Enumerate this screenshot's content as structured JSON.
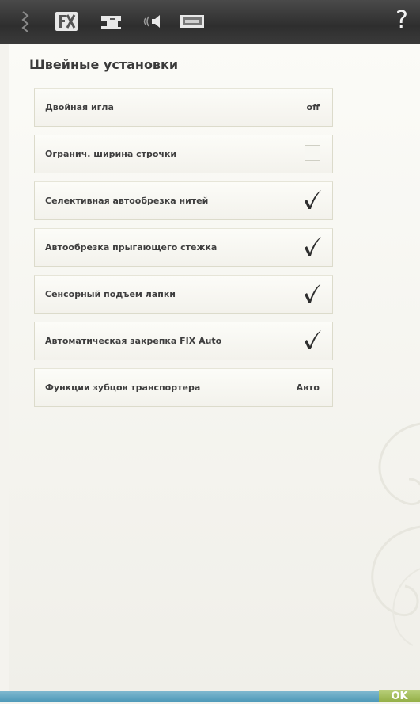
{
  "toolbar": {
    "icons": [
      "stitch-settings-icon",
      "fix-icon",
      "sewing-machine-icon",
      "sound-icon",
      "screen-icon"
    ],
    "help_label": "?"
  },
  "page": {
    "title": "Швейные установки"
  },
  "settings": [
    {
      "label": "Двойная игла",
      "value": "off",
      "control": "value"
    },
    {
      "label": "Огранич. ширина строчки",
      "control": "checkbox",
      "checked": false
    },
    {
      "label": "Селективная автообрезка нитей",
      "control": "checkbox",
      "checked": true
    },
    {
      "label": "Автообрезка прыгающего стежка",
      "control": "checkbox",
      "checked": true
    },
    {
      "label": "Сенсорный подъем лапки",
      "control": "checkbox",
      "checked": true
    },
    {
      "label": "Автоматическая закрепка FIX Auto",
      "control": "checkbox",
      "checked": true
    },
    {
      "label": "Функции зубцов транспортера",
      "value": "Авто",
      "control": "value"
    }
  ],
  "footer": {
    "ok_label": "OK"
  },
  "colors": {
    "topbar": "#3a3a3a",
    "bottombar": "#5aa3c2",
    "ok_button": "#a2bd55"
  }
}
